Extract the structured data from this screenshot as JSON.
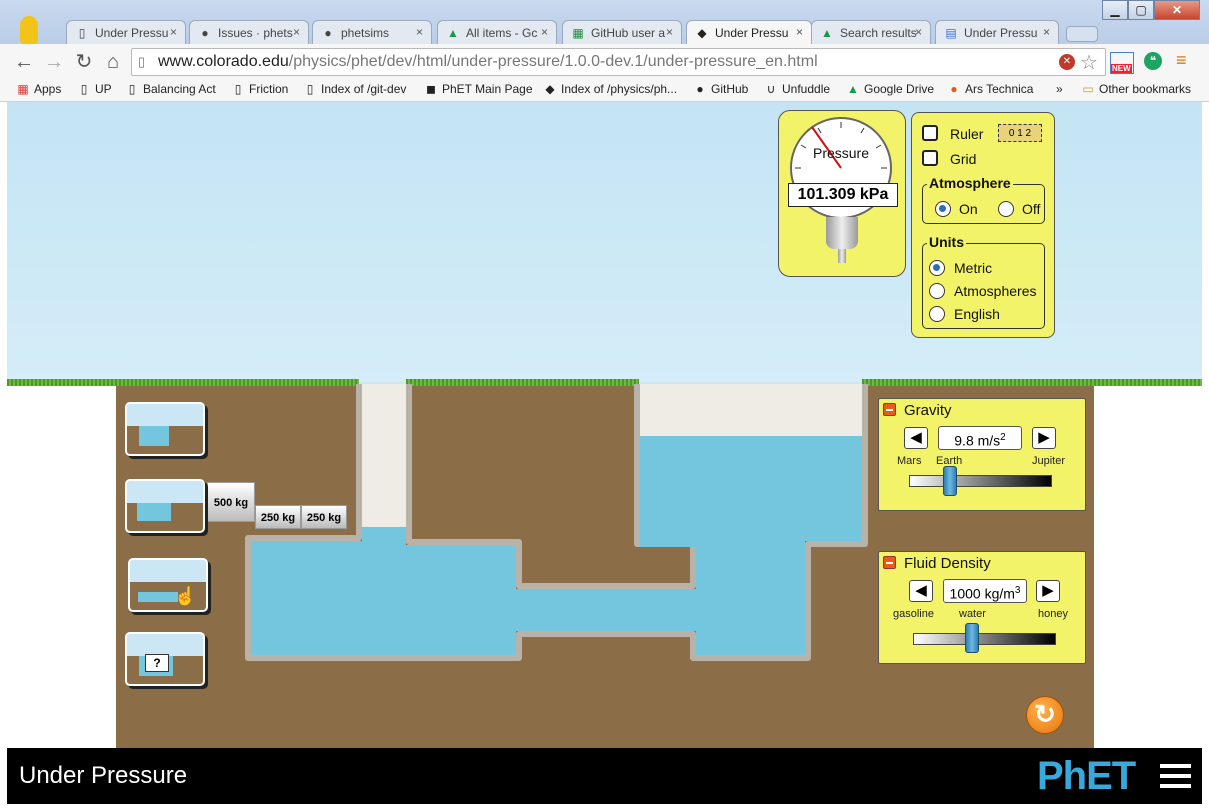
{
  "browser": {
    "tabs": [
      {
        "label": "Under Pressu",
        "icon": "page-icon"
      },
      {
        "label": "Issues · phets",
        "icon": "github-icon"
      },
      {
        "label": "phetsims",
        "icon": "github-icon"
      },
      {
        "label": "All items - Gc",
        "icon": "drive-icon"
      },
      {
        "label": "GitHub user a",
        "icon": "sheets-icon"
      },
      {
        "label": "Under Pressu",
        "icon": "cu-icon"
      },
      {
        "label": "Search results",
        "icon": "drive-icon"
      },
      {
        "label": "Under Pressu",
        "icon": "docs-icon"
      }
    ],
    "close_glyph": "×",
    "url_host": "www.colorado.edu",
    "url_path": "/physics/phet/dev/html/under-pressure/1.0.0-dev.1/under-pressure_en.html",
    "bookmarks": [
      "Apps",
      "UP",
      "Balancing Act",
      "Friction",
      "Index of /git-dev",
      "PhET Main Page",
      "Index of /physics/ph...",
      "GitHub",
      "Unfuddle",
      "Google Drive",
      "Ars Technica"
    ],
    "bookmarks_overflow": "»",
    "other_bookmarks": "Other bookmarks",
    "new_badge": "NEW"
  },
  "sim": {
    "title": "Under Pressure",
    "logo": "PhET",
    "gauge": {
      "label": "Pressure",
      "value": "101.309 kPa"
    },
    "controls": {
      "ruler_label": "Ruler",
      "ruler_icon_text": "0 1 2",
      "grid_label": "Grid",
      "ruler_checked": false,
      "grid_checked": false
    },
    "atmosphere": {
      "title": "Atmosphere",
      "on": "On",
      "off": "Off",
      "selected": "On"
    },
    "units": {
      "title": "Units",
      "options": [
        "Metric",
        "Atmospheres",
        "English"
      ],
      "selected": "Metric"
    },
    "gravity": {
      "title": "Gravity",
      "value": "9.8 m/s",
      "value_exp": "2",
      "left_label": "Mars",
      "mid_label": "Earth",
      "right_label": "Jupiter"
    },
    "density": {
      "title": "Fluid Density",
      "value": "1000 kg/m",
      "value_exp": "3",
      "left_label": "gasoline",
      "mid_label": "water",
      "right_label": "honey"
    },
    "masses": [
      "500 kg",
      "250 kg",
      "250 kg"
    ],
    "mystery_label": "?",
    "colors": {
      "sky": "#cbe6f4",
      "earth": "#8b6d47",
      "water": "#74c6df",
      "panel": "#f3f36a",
      "reset": "#f28c1c"
    }
  }
}
